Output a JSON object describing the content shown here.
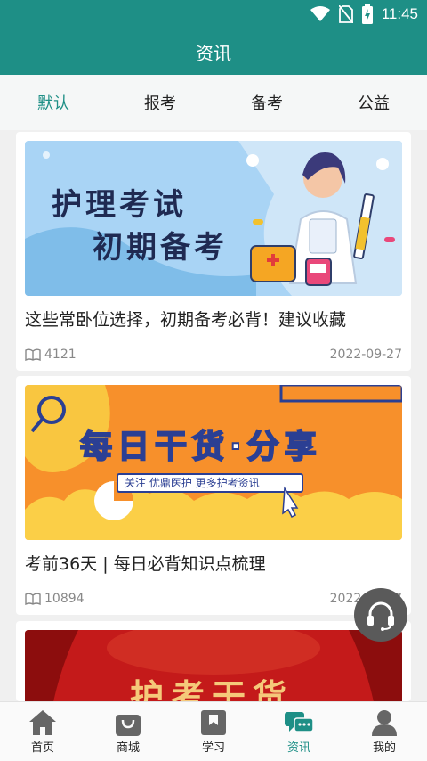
{
  "status": {
    "time": "11:45"
  },
  "header": {
    "title": "资讯"
  },
  "tabs": [
    {
      "label": "默认",
      "active": true
    },
    {
      "label": "报考",
      "active": false
    },
    {
      "label": "备考",
      "active": false
    },
    {
      "label": "公益",
      "active": false
    }
  ],
  "articles": [
    {
      "banner": {
        "line1": "护理考试",
        "line2": "初期备考"
      },
      "title": "这些常卧位选择，初期备考必背！建议收藏",
      "views": "4121",
      "date": "2022-09-27"
    },
    {
      "banner": {
        "headline": "每日干货·分享",
        "sub": "关注 优鼎医护 更多护考资讯"
      },
      "title": "考前36天 | 每日必背知识点梳理",
      "views": "10894",
      "date": "2022-09-17"
    },
    {
      "banner": {
        "headline": "护考干货"
      }
    }
  ],
  "bottom_nav": [
    {
      "label": "首页",
      "icon": "home-icon"
    },
    {
      "label": "商城",
      "icon": "shopping-bag-icon"
    },
    {
      "label": "学习",
      "icon": "book-icon"
    },
    {
      "label": "资讯",
      "icon": "chat-news-icon",
      "active": true
    },
    {
      "label": "我的",
      "icon": "person-icon"
    }
  ],
  "colors": {
    "primary": "#1e8f86",
    "banner2": "#f7902b",
    "banner3": "#c41a1a"
  }
}
